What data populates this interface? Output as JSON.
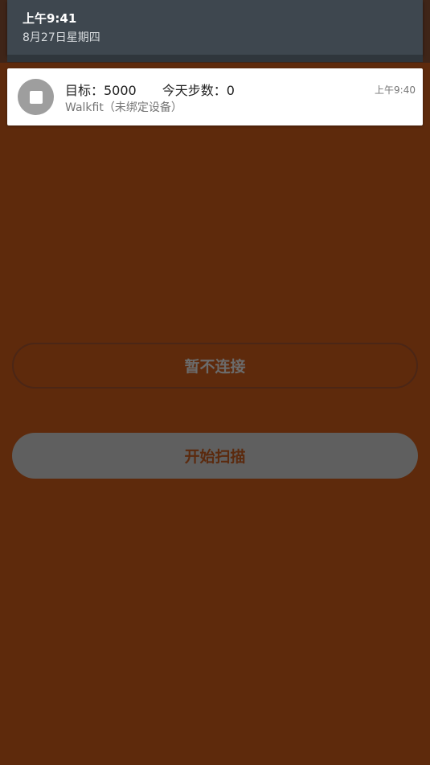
{
  "status": {
    "time": "上午9:41",
    "date": "8月27日星期四"
  },
  "notification": {
    "icon": "stop-square-icon",
    "goal_text": "目标：5000",
    "steps_text": "今天步数：0",
    "subtitle": "Walkfit（未绑定设备）",
    "timestamp": "上午9:40"
  },
  "buttons": {
    "skip_connect": "暂不连接",
    "start_scan": "开始扫描"
  },
  "colors": {
    "background": "#5e2a0c",
    "panel": "#3e474f",
    "button_fill": "#5f5f5f"
  }
}
